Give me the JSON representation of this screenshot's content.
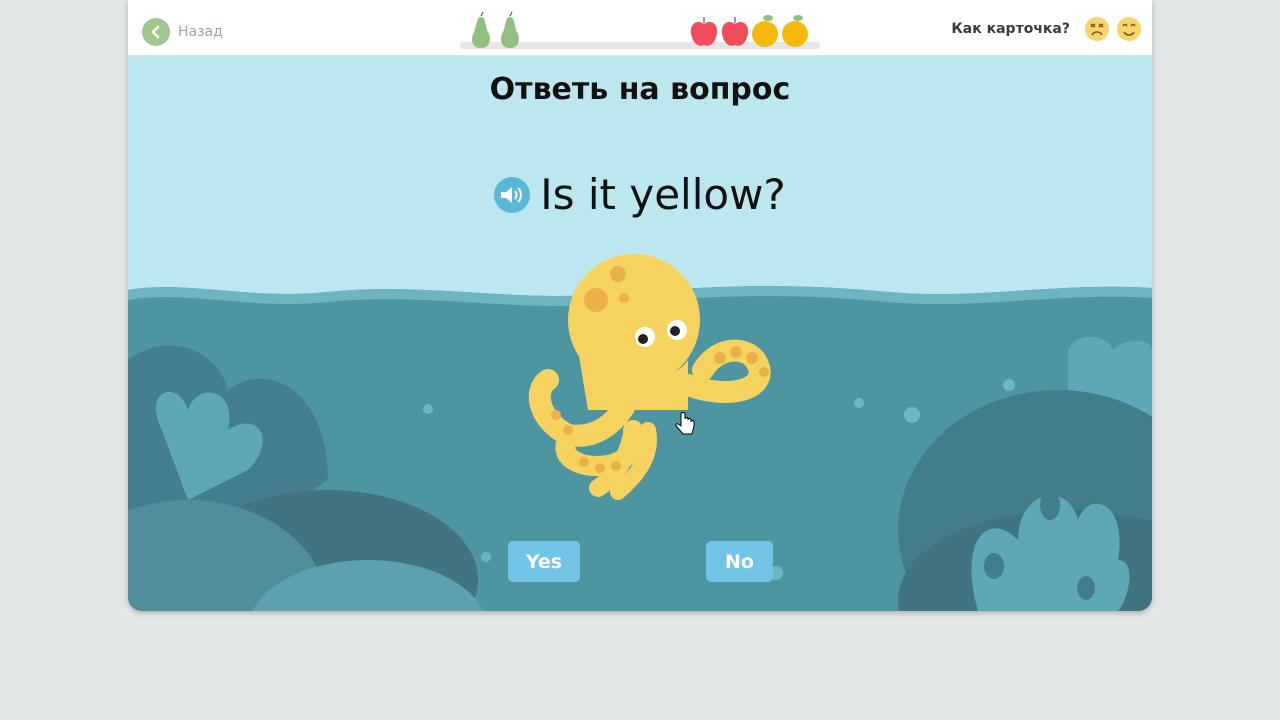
{
  "header": {
    "back_label": "Назад",
    "rating_label": "Как карточка?",
    "progress_icons": [
      "pear-icon",
      "pear-icon",
      "apple-icon",
      "apple-icon",
      "orange-icon",
      "orange-icon"
    ],
    "rating_icons": [
      "sad-face-icon",
      "happy-face-icon"
    ]
  },
  "task": {
    "title": "Ответь на вопрос",
    "question": "Is it yellow?"
  },
  "answers": {
    "yes": "Yes",
    "no": "No"
  },
  "colors": {
    "sky": "#bde7ef",
    "sea": "#4e95a2",
    "octopus": "#f6d35f",
    "button": "#72c4e6",
    "back_accent": "#9fc88f"
  }
}
